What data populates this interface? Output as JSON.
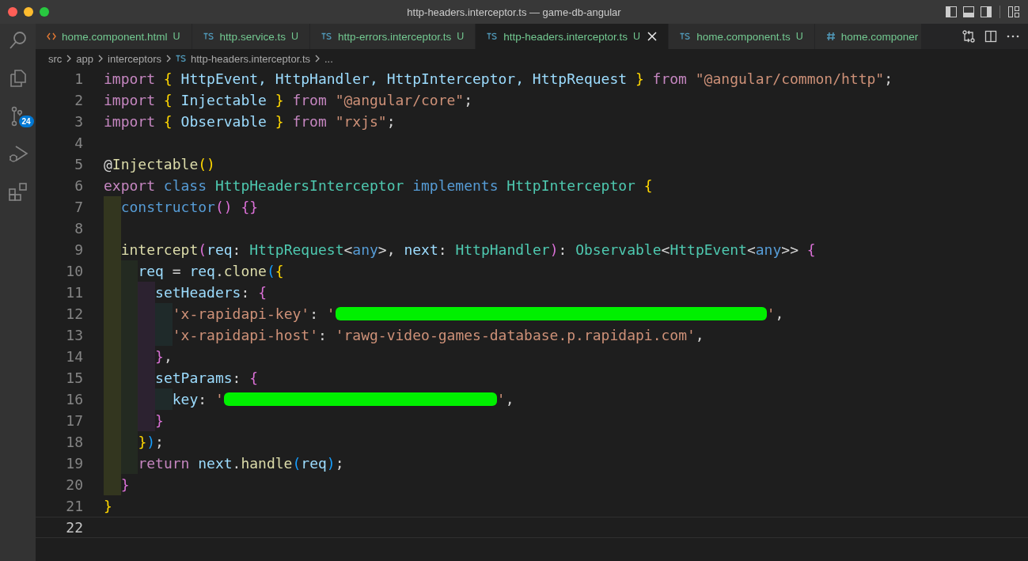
{
  "window": {
    "title": "http-headers.interceptor.ts — game-db-angular"
  },
  "activity_bar": {
    "source_control_badge": "24"
  },
  "tabs": [
    {
      "label": "home.component.html",
      "kind": "html",
      "status": "U",
      "selected": false
    },
    {
      "label": "http.service.ts",
      "kind": "ts",
      "status": "U",
      "selected": false
    },
    {
      "label": "http-errors.interceptor.ts",
      "kind": "ts",
      "status": "U",
      "selected": false
    },
    {
      "label": "http-headers.interceptor.ts",
      "kind": "ts",
      "status": "U",
      "selected": true
    },
    {
      "label": "home.component.ts",
      "kind": "ts",
      "status": "U",
      "selected": false
    },
    {
      "label": "home.componer",
      "kind": "css",
      "selected": false
    }
  ],
  "breadcrumb": [
    {
      "label": "src",
      "kind": "folder"
    },
    {
      "label": "app",
      "kind": "folder"
    },
    {
      "label": "interceptors",
      "kind": "folder"
    },
    {
      "label": "http-headers.interceptor.ts",
      "kind": "ts"
    },
    {
      "label": "...",
      "kind": "folder"
    }
  ],
  "editor": {
    "lines": [
      {
        "number": "1",
        "tokens": [
          {
            "kind": "keyword",
            "text": "import "
          },
          {
            "kind": "bracket1",
            "text": "{"
          },
          {
            "kind": "variable",
            "text": " HttpEvent, HttpHandler, HttpInterceptor, HttpRequest "
          },
          {
            "kind": "bracket1",
            "text": "}"
          },
          {
            "kind": "keyword",
            "text": " from "
          },
          {
            "kind": "string",
            "text": "\"@angular/common/http\""
          },
          {
            "kind": "plain",
            "text": ";"
          }
        ]
      },
      {
        "number": "2",
        "tokens": [
          {
            "kind": "keyword",
            "text": "import "
          },
          {
            "kind": "bracket1",
            "text": "{"
          },
          {
            "kind": "variable",
            "text": " Injectable "
          },
          {
            "kind": "bracket1",
            "text": "}"
          },
          {
            "kind": "keyword",
            "text": " from "
          },
          {
            "kind": "string",
            "text": "\"@angular/core\""
          },
          {
            "kind": "plain",
            "text": ";"
          }
        ]
      },
      {
        "number": "3",
        "tokens": [
          {
            "kind": "keyword",
            "text": "import "
          },
          {
            "kind": "bracket1",
            "text": "{"
          },
          {
            "kind": "variable",
            "text": " Observable "
          },
          {
            "kind": "bracket1",
            "text": "}"
          },
          {
            "kind": "keyword",
            "text": " from "
          },
          {
            "kind": "string",
            "text": "\"rxjs\""
          },
          {
            "kind": "plain",
            "text": ";"
          }
        ]
      },
      {
        "number": "4"
      },
      {
        "number": "5",
        "tokens": [
          {
            "kind": "plain",
            "text": "@"
          },
          {
            "kind": "function",
            "text": "Injectable"
          },
          {
            "kind": "bracket1",
            "text": "()"
          }
        ]
      },
      {
        "number": "6",
        "tokens": [
          {
            "kind": "keyword",
            "text": "export "
          },
          {
            "kind": "storage",
            "text": "class "
          },
          {
            "kind": "type",
            "text": "HttpHeadersInterceptor "
          },
          {
            "kind": "storage",
            "text": "implements "
          },
          {
            "kind": "type",
            "text": "HttpInterceptor "
          },
          {
            "kind": "bracket1",
            "text": "{"
          }
        ]
      },
      {
        "number": "7",
        "tokens": [
          {
            "kind": "guide"
          },
          {
            "kind": "storage",
            "text": "constructor"
          },
          {
            "kind": "bracket2",
            "text": "() {}"
          }
        ]
      },
      {
        "number": "8",
        "tokens": [
          {
            "kind": "guide"
          }
        ]
      },
      {
        "number": "9",
        "tokens": [
          {
            "kind": "guide"
          },
          {
            "kind": "function",
            "text": "intercept"
          },
          {
            "kind": "bracket2",
            "text": "("
          },
          {
            "kind": "variable",
            "text": "req"
          },
          {
            "kind": "plain",
            "text": ": "
          },
          {
            "kind": "type",
            "text": "HttpRequest"
          },
          {
            "kind": "plain",
            "text": "<"
          },
          {
            "kind": "storage",
            "text": "any"
          },
          {
            "kind": "plain",
            "text": ">, "
          },
          {
            "kind": "variable",
            "text": "next"
          },
          {
            "kind": "plain",
            "text": ": "
          },
          {
            "kind": "type",
            "text": "HttpHandler"
          },
          {
            "kind": "bracket2",
            "text": ")"
          },
          {
            "kind": "plain",
            "text": ": "
          },
          {
            "kind": "type",
            "text": "Observable"
          },
          {
            "kind": "plain",
            "text": "<"
          },
          {
            "kind": "type",
            "text": "HttpEvent"
          },
          {
            "kind": "plain",
            "text": "<"
          },
          {
            "kind": "storage",
            "text": "any"
          },
          {
            "kind": "plain",
            "text": ">> "
          },
          {
            "kind": "bracket2",
            "text": "{"
          }
        ]
      },
      {
        "number": "10",
        "tokens": [
          {
            "kind": "guide"
          },
          {
            "kind": "guide"
          },
          {
            "kind": "variable",
            "text": "req"
          },
          {
            "kind": "plain",
            "text": " = "
          },
          {
            "kind": "variable",
            "text": "req"
          },
          {
            "kind": "plain",
            "text": "."
          },
          {
            "kind": "function",
            "text": "clone"
          },
          {
            "kind": "bracket3",
            "text": "("
          },
          {
            "kind": "bracket1",
            "text": "{"
          }
        ]
      },
      {
        "number": "11",
        "tokens": [
          {
            "kind": "guide"
          },
          {
            "kind": "guide"
          },
          {
            "kind": "guide"
          },
          {
            "kind": "variable",
            "text": "setHeaders"
          },
          {
            "kind": "plain",
            "text": ": "
          },
          {
            "kind": "bracket2",
            "text": "{"
          }
        ]
      },
      {
        "number": "12",
        "tokens": [
          {
            "kind": "guide"
          },
          {
            "kind": "guide"
          },
          {
            "kind": "guide"
          },
          {
            "kind": "guide"
          },
          {
            "kind": "string",
            "text": "'x-rapidapi-key'"
          },
          {
            "kind": "plain",
            "text": ": "
          },
          {
            "kind": "string",
            "text": "'"
          },
          {
            "kind": "redaction"
          },
          {
            "kind": "string",
            "text": "'"
          },
          {
            "kind": "plain",
            "text": ","
          }
        ]
      },
      {
        "number": "13",
        "tokens": [
          {
            "kind": "guide"
          },
          {
            "kind": "guide"
          },
          {
            "kind": "guide"
          },
          {
            "kind": "guide"
          },
          {
            "kind": "string",
            "text": "'x-rapidapi-host'"
          },
          {
            "kind": "plain",
            "text": ": "
          },
          {
            "kind": "string",
            "text": "'rawg-video-games-database.p.rapidapi.com'"
          },
          {
            "kind": "plain",
            "text": ","
          }
        ]
      },
      {
        "number": "14",
        "tokens": [
          {
            "kind": "guide"
          },
          {
            "kind": "guide"
          },
          {
            "kind": "guide"
          },
          {
            "kind": "bracket2",
            "text": "}"
          },
          {
            "kind": "plain",
            "text": ","
          }
        ]
      },
      {
        "number": "15",
        "tokens": [
          {
            "kind": "guide"
          },
          {
            "kind": "guide"
          },
          {
            "kind": "guide"
          },
          {
            "kind": "variable",
            "text": "setParams"
          },
          {
            "kind": "plain",
            "text": ": "
          },
          {
            "kind": "bracket2",
            "text": "{"
          }
        ]
      },
      {
        "number": "16",
        "tokens": [
          {
            "kind": "guide"
          },
          {
            "kind": "guide"
          },
          {
            "kind": "guide"
          },
          {
            "kind": "guide"
          },
          {
            "kind": "variable",
            "text": "key"
          },
          {
            "kind": "plain",
            "text": ": "
          },
          {
            "kind": "string",
            "text": "'"
          },
          {
            "kind": "redaction"
          },
          {
            "kind": "string",
            "text": "'"
          },
          {
            "kind": "plain",
            "text": ","
          }
        ]
      },
      {
        "number": "17",
        "tokens": [
          {
            "kind": "guide"
          },
          {
            "kind": "guide"
          },
          {
            "kind": "guide"
          },
          {
            "kind": "bracket2",
            "text": "}"
          }
        ]
      },
      {
        "number": "18",
        "tokens": [
          {
            "kind": "guide"
          },
          {
            "kind": "guide"
          },
          {
            "kind": "bracket1",
            "text": "}"
          },
          {
            "kind": "bracket3",
            "text": ")"
          },
          {
            "kind": "plain",
            "text": ";"
          }
        ]
      },
      {
        "number": "19",
        "tokens": [
          {
            "kind": "guide"
          },
          {
            "kind": "guide"
          },
          {
            "kind": "keyword",
            "text": "return "
          },
          {
            "kind": "variable",
            "text": "next"
          },
          {
            "kind": "plain",
            "text": "."
          },
          {
            "kind": "function",
            "text": "handle"
          },
          {
            "kind": "bracket3",
            "text": "("
          },
          {
            "kind": "variable",
            "text": "req"
          },
          {
            "kind": "bracket3",
            "text": ")"
          },
          {
            "kind": "plain",
            "text": ";"
          }
        ]
      },
      {
        "number": "20",
        "tokens": [
          {
            "kind": "guide"
          },
          {
            "kind": "bracket2",
            "text": "}"
          }
        ]
      },
      {
        "number": "21",
        "tokens": [
          {
            "kind": "bracket1",
            "text": "}"
          }
        ]
      },
      {
        "number": "22",
        "current": true
      }
    ]
  }
}
